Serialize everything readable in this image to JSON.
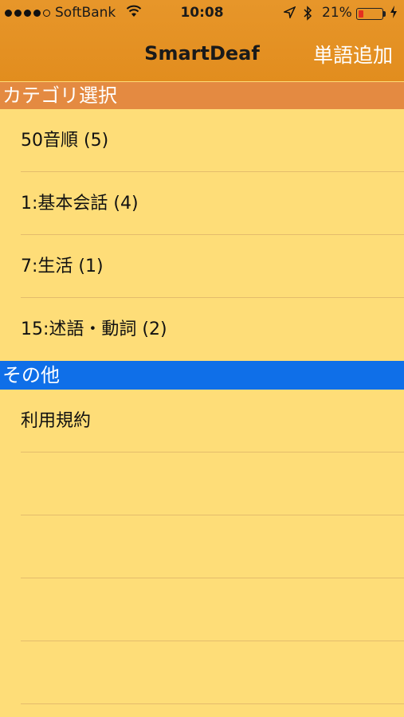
{
  "status_bar": {
    "carrier": "SoftBank",
    "time": "10:08",
    "battery_percent": "21%",
    "battery_level": 0.21
  },
  "nav": {
    "title": "SmartDeaf",
    "add_button": "単語追加"
  },
  "sections": [
    {
      "header": "カテゴリ選択",
      "rows": [
        "50音順 (5)",
        "1:基本会話 (4)",
        "7:生活 (1)",
        "15:述語・動詞 (2)"
      ]
    },
    {
      "header": "その他",
      "rows": [
        "利用規約"
      ]
    }
  ],
  "colors": {
    "nav_background": "#e3901f",
    "section1_header": "#e48a41",
    "section2_header": "#0f6fe8",
    "list_background": "#fedd78",
    "separator": "#e4bc6c"
  }
}
